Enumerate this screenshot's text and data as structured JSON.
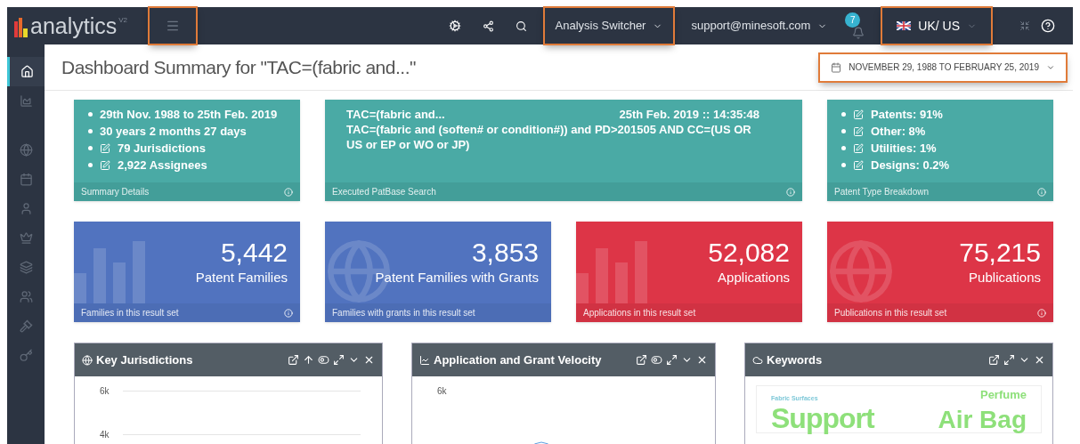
{
  "app": {
    "logo": "analytics",
    "version": "V2"
  },
  "topbar": {
    "menu_highlighted": true,
    "dropdowns": [
      {
        "label": "Analysis Switcher",
        "highlighted": true
      },
      {
        "label": "support@minesoft.com",
        "highlighted": false
      }
    ],
    "notifications": "7",
    "locale": {
      "label": "UK/ US",
      "highlighted": true
    }
  },
  "sidebar": {
    "items": [
      {
        "kind": "home",
        "selected": true
      },
      {
        "kind": "area",
        "selected": false
      },
      {
        "kind": "globe",
        "selected": false
      },
      {
        "kind": "calendar",
        "selected": false
      },
      {
        "kind": "user",
        "selected": false
      },
      {
        "kind": "chess",
        "selected": false
      },
      {
        "kind": "layers",
        "selected": false
      },
      {
        "kind": "users",
        "selected": false
      },
      {
        "kind": "gavel",
        "selected": false
      },
      {
        "kind": "key",
        "selected": false
      }
    ]
  },
  "page_title": "Dashboard Summary for \"TAC=(fabric and...\"",
  "date_range": {
    "label": "NOVEMBER 29, 1988 TO FEBRUARY 25, 2019",
    "highlighted": true
  },
  "summary_card": {
    "bullets": [
      {
        "text": "29th Nov. 1988 to 25th Feb. 2019",
        "link": false
      },
      {
        "text": "30 years 2 months 27 days",
        "link": false
      },
      {
        "text": "79 Jurisdictions",
        "link": true
      },
      {
        "text": "2,922 Assignees",
        "link": true
      }
    ],
    "footer": "Summary Details"
  },
  "search_card": {
    "title": "TAC=(fabric and...",
    "time": "25th Feb. 2019 :: 14:35:48",
    "query": "TAC=(fabric and (soften# or condition#)) and PD>201505 AND CC=(US OR US or EP or WO or JP)",
    "footer": "Executed PatBase Search"
  },
  "type_card": {
    "bullets": [
      {
        "text": "Patents: 91%",
        "link": true
      },
      {
        "text": "Other: 8%",
        "link": true
      },
      {
        "text": "Utilities: 1%",
        "link": true
      },
      {
        "text": "Designs: 0.2%",
        "link": true
      }
    ],
    "footer": "Patent Type Breakdown"
  },
  "stat_cards": [
    {
      "value": "5,442",
      "label": "Patent Families",
      "footer": "Families in this result set",
      "color": "#5173bf",
      "kind": "bars",
      "info": true
    },
    {
      "value": "3,853",
      "label": "Patent Families with Grants",
      "footer": "Families with grants in this result set",
      "color": "#5173bf",
      "kind": "globe",
      "info": false
    },
    {
      "value": "52,082",
      "label": "Applications",
      "footer": "Applications in this result set",
      "color": "#dd3547",
      "kind": "bars",
      "info": false
    },
    {
      "value": "75,215",
      "label": "Publications",
      "footer": "Publications in this result set",
      "color": "#dd3547",
      "kind": "globe",
      "info": true
    }
  ],
  "panels": [
    {
      "title": "Key Jurisdictions",
      "kind": "bars",
      "axis_labels": [
        "6k",
        "4k"
      ]
    },
    {
      "title": "Application and Grant Velocity",
      "kind": "line",
      "axis_labels": [
        "6k"
      ]
    },
    {
      "title": "Keywords",
      "kind": "cloud",
      "words": [
        {
          "text": "Fabric Surfaces",
          "kind": "small",
          "color": "#7ec8d8"
        },
        {
          "text": "Perfume",
          "kind": "medium",
          "color": "#8ee07a"
        },
        {
          "text": "Support",
          "kind": "large",
          "color": "#8ee07a"
        },
        {
          "text": "Air Bag",
          "kind": "big",
          "color": "#8ee07a"
        }
      ]
    }
  ]
}
